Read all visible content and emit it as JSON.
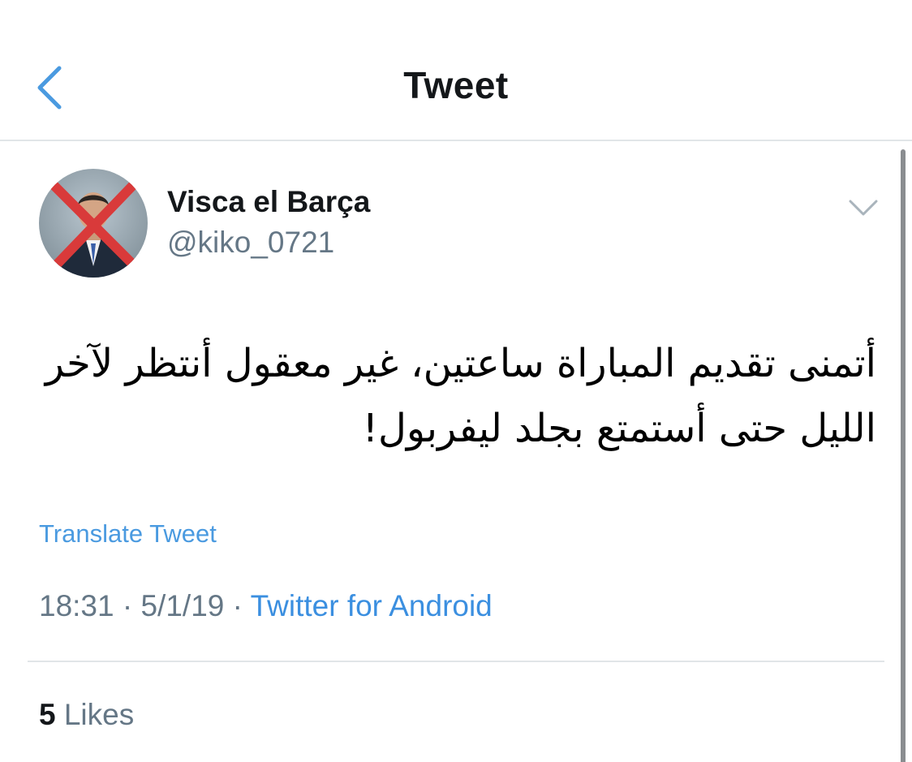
{
  "header": {
    "title": "Tweet",
    "back_icon": "chevron-left-icon"
  },
  "tweet": {
    "author": {
      "display_name": "Visca el Barça",
      "handle": "@kiko_0721"
    },
    "text": "أتمنى تقديم المباراة ساعتين، غير معقول أنتظر لآخر الليل حتى أستمتع بجلد ليفربول!",
    "translate_label": "Translate Tweet",
    "time": "18:31",
    "separator": " · ",
    "date": "5/1/19",
    "source": "Twitter for Android",
    "likes_count": "5",
    "likes_label": "Likes"
  },
  "colors": {
    "accent": "#4a9ae0",
    "secondary_text": "#657786",
    "divider": "#e1e5e8",
    "cross": "#d93a3a"
  }
}
